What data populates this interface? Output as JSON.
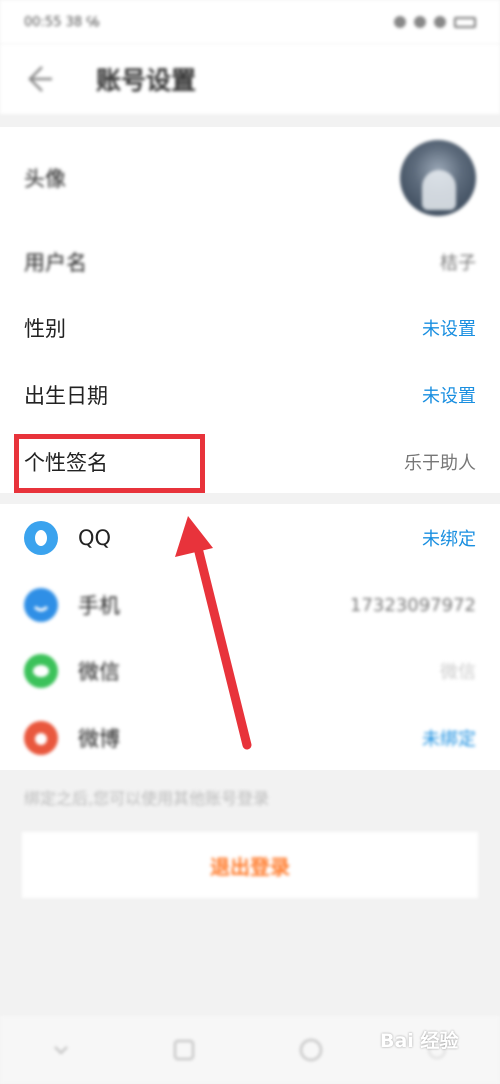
{
  "status_bar": {
    "time": "00:55 38 ℅"
  },
  "header": {
    "title": "账号设置"
  },
  "profile": {
    "avatar_label": "头像",
    "username_label": "用户名",
    "username_value": "桔子",
    "gender_label": "性别",
    "gender_value": "未设置",
    "birthday_label": "出生日期",
    "birthday_value": "未设置",
    "signature_label": "个性签名",
    "signature_value": "乐于助人"
  },
  "bindings": [
    {
      "label": "QQ",
      "value": "未绑定",
      "icon": "qq-icon",
      "color": "#3ba3ee"
    },
    {
      "label": "手机",
      "value": "17323097972",
      "icon": "phone-icon",
      "color": "#2f8fe6"
    },
    {
      "label": "微信",
      "value": "微信",
      "icon": "wechat-icon",
      "color": "#3cc25a"
    },
    {
      "label": "微博",
      "value": "未绑定",
      "icon": "weibo-icon",
      "color": "#e9583e"
    }
  ],
  "hint": "绑定之后,您可以使用其他账号登录",
  "logout_label": "退出登录",
  "watermark": "Bai 经验",
  "colors": {
    "link": "#1a8fe0",
    "highlight": "#e8333b",
    "logout": "#ff7a2a"
  }
}
